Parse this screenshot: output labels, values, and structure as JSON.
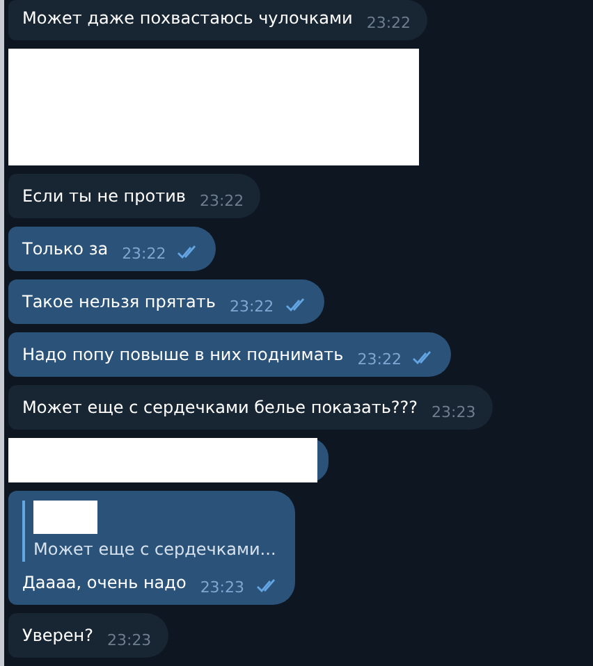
{
  "messages": [
    {
      "kind": "message",
      "outgoing": false,
      "text": "Может даже похвастаюсь чулочками",
      "time": "23:22"
    },
    {
      "kind": "redaction",
      "outgoing": false
    },
    {
      "kind": "message",
      "outgoing": false,
      "text": "Если ты не против",
      "time": "23:22"
    },
    {
      "kind": "message",
      "outgoing": true,
      "read": true,
      "text": "Только за",
      "time": "23:22"
    },
    {
      "kind": "message",
      "outgoing": true,
      "read": true,
      "text": "Такое нельзя прятать",
      "time": "23:22"
    },
    {
      "kind": "message",
      "outgoing": true,
      "read": true,
      "text": "Надо попу повыше в них поднимать",
      "time": "23:22"
    },
    {
      "kind": "message",
      "outgoing": false,
      "text": "Может еще с сердечками белье показать???",
      "time": "23:23"
    },
    {
      "kind": "redaction",
      "outgoing": true
    },
    {
      "kind": "message",
      "outgoing": true,
      "read": true,
      "reply": {
        "quote": "Может еще с сердечками..."
      },
      "text": "Даааа, очень надо",
      "time": "23:23"
    },
    {
      "kind": "message",
      "outgoing": false,
      "text": "Уверен?",
      "time": "23:23"
    }
  ]
}
